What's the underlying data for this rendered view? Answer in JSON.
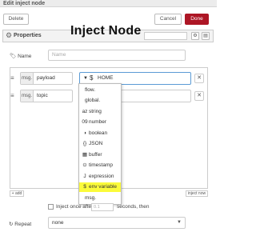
{
  "window": {
    "title": "Edit inject node"
  },
  "toolbar": {
    "delete_label": "Delete",
    "cancel_label": "Cancel",
    "done_label": "Done"
  },
  "section": {
    "label": "Properties"
  },
  "overlay": {
    "title": "Inject Node"
  },
  "name_field": {
    "label": "Name",
    "placeholder": "Name"
  },
  "properties": [
    {
      "prefix": "msg.",
      "name": "payload",
      "type_icon": "$",
      "value": "HOME"
    },
    {
      "prefix": "msg.",
      "name": "topic",
      "type_icon": "",
      "value": ""
    }
  ],
  "type_dropdown": {
    "items": [
      {
        "icon": "",
        "label": "flow."
      },
      {
        "icon": "",
        "label": "global."
      },
      {
        "icon": "az",
        "label": "string"
      },
      {
        "icon": "09",
        "label": "number"
      },
      {
        "icon": "◑",
        "label": "boolean"
      },
      {
        "icon": "{}",
        "label": "JSON"
      },
      {
        "icon": "▦",
        "label": "buffer"
      },
      {
        "icon": "⊙",
        "label": "timestamp"
      },
      {
        "icon": "J",
        "label": "expression"
      },
      {
        "icon": "$",
        "label": "env variable",
        "selected": true
      },
      {
        "icon": "",
        "label": "msg."
      }
    ],
    "highlight_color": "#fbfb3a"
  },
  "list_buttons": {
    "add_label": "+ add",
    "inject_label": "inject now"
  },
  "inject_once": {
    "label": "Inject once after",
    "value": "0.1",
    "suffix": "seconds, then"
  },
  "repeat": {
    "label": "Repeat",
    "selected": "none"
  },
  "colors": {
    "done_button": "#ad1625",
    "focus_border": "#5b9bd5"
  }
}
